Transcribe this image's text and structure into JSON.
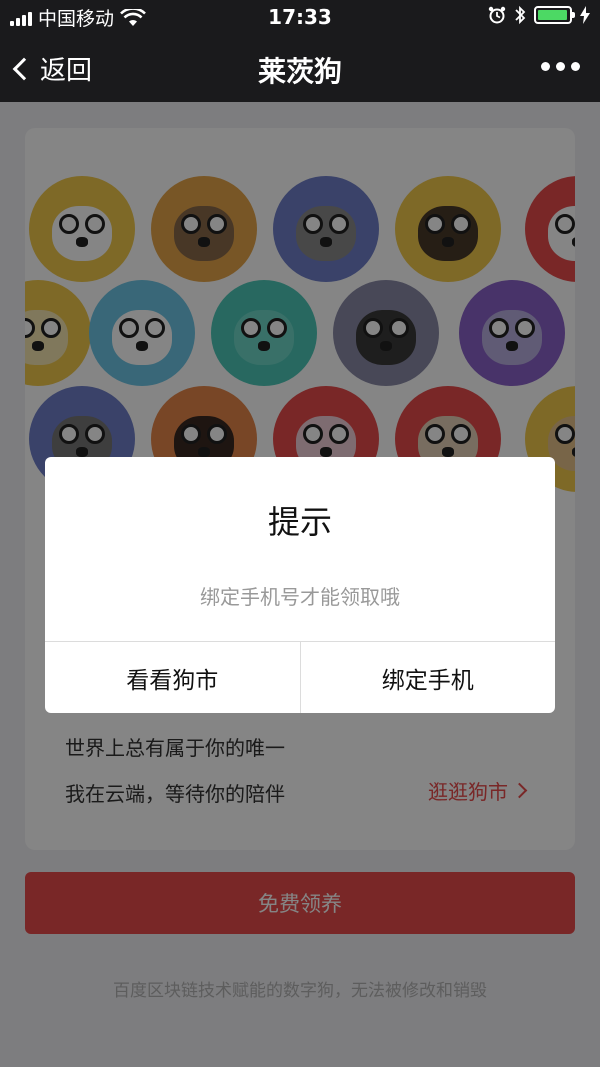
{
  "status_bar": {
    "carrier": "中国移动",
    "time": "17:33",
    "battery_level": 0.95,
    "icons": [
      "signal-icon",
      "wifi-icon",
      "alarm-icon",
      "bluetooth-icon",
      "battery-icon",
      "charging-icon"
    ]
  },
  "nav": {
    "back_label": "返回",
    "title": "莱茨狗",
    "more_icon": "more-dots-icon"
  },
  "avatars": [
    {
      "color": "#f2c94c",
      "face": "#ffffff"
    },
    {
      "color": "#e6a64a",
      "face": "#8a6a4a"
    },
    {
      "color": "#6f7fc9",
      "face": "#8a8a8a"
    },
    {
      "color": "#f2c94c",
      "face": "#4a3a2a"
    },
    {
      "color": "#e84b4b",
      "face": "#ffffff"
    },
    {
      "color": "#f2c94c",
      "face": "#f5e6b0"
    },
    {
      "color": "#6ec6e6",
      "face": "#ffffff"
    },
    {
      "color": "#4ec8b8",
      "face": "#6ed6c8"
    },
    {
      "color": "#8a8aa8",
      "face": "#3a3a3a"
    },
    {
      "color": "#8a62c9",
      "face": "#b8aee0"
    },
    {
      "color": "#6f7fc9",
      "face": "#777777"
    },
    {
      "color": "#e6874a",
      "face": "#3a2a22"
    },
    {
      "color": "#e84b4b",
      "face": "#f2d0d8"
    },
    {
      "color": "#e84b4b",
      "face": "#e6d2b8"
    },
    {
      "color": "#f2c94c",
      "face": "#e6c28a"
    }
  ],
  "slogan": {
    "line1": "世界上总有属于你的唯一",
    "line2": "我在云端，等待你的陪伴"
  },
  "market_link": "逛逛狗市",
  "claim_button": "免费领养",
  "footer_note": "百度区块链技术赋能的数字狗，无法被修改和销毁",
  "dialog": {
    "title": "提示",
    "message": "绑定手机号才能领取哦",
    "left_button": "看看狗市",
    "right_button": "绑定手机"
  }
}
